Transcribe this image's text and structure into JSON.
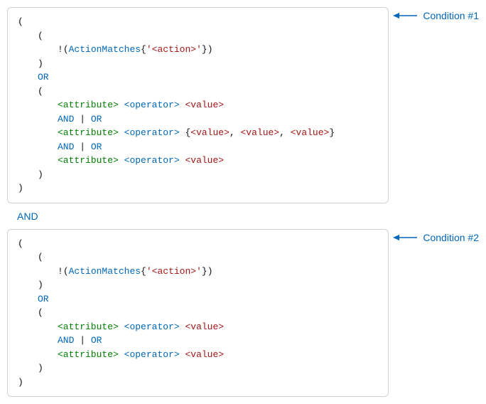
{
  "labels": {
    "condition1": "Condition #1",
    "condition2": "Condition #2",
    "and_between": "AND"
  },
  "tokens": {
    "paren_open": "(",
    "paren_close": ")",
    "brace_open": "{",
    "brace_close": "}",
    "bang": "!",
    "comma": ", ",
    "action_matches": "ActionMatches",
    "action_quoted": "'<action>'",
    "or_kw": "OR",
    "and_kw": "AND",
    "pipe": " | ",
    "attribute": "<attribute>",
    "operator": "<operator>",
    "value": "<value>"
  }
}
